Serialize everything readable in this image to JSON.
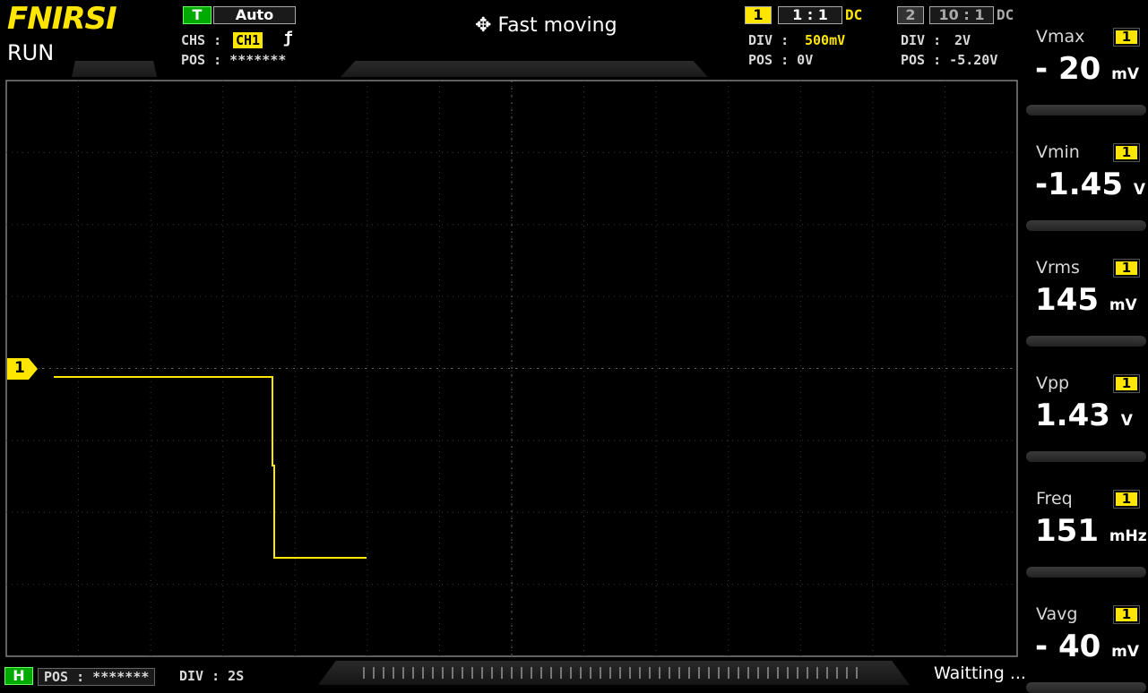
{
  "header": {
    "brand": "FNIRSI",
    "run_state": "RUN",
    "trigger": {
      "badge": "T",
      "mode": "Auto",
      "chs_label": "CHS :",
      "channel": "CH1",
      "edge_symbol": "ƒ",
      "pos_label": "POS : *******"
    },
    "title": "Fast moving",
    "ch1": {
      "num": "1",
      "probe": "1 : 1",
      "coupling": "DC",
      "div_label": "DIV :",
      "div_value": "500mV",
      "pos_label": "POS : 0V"
    },
    "ch2": {
      "num": "2",
      "probe": "10 : 1",
      "coupling": "DC",
      "div_label": "DIV :",
      "div_value": "2V",
      "pos_label": "POS : -5.20V"
    }
  },
  "measurements": [
    {
      "label": "Vmax",
      "badge": "1",
      "value": "- 20",
      "unit": "mV"
    },
    {
      "label": "Vmin",
      "badge": "1",
      "value": "-1.45",
      "unit": "V"
    },
    {
      "label": "Vrms",
      "badge": "1",
      "value": "145",
      "unit": "mV"
    },
    {
      "label": "Vpp",
      "badge": "1",
      "value": "1.43",
      "unit": "V"
    },
    {
      "label": "Freq",
      "badge": "1",
      "value": "151",
      "unit": "mHz"
    },
    {
      "label": "Vavg",
      "badge": "1",
      "value": "- 40",
      "unit": "mV"
    }
  ],
  "footer": {
    "h_badge": "H",
    "pos_label": "POS : *******",
    "div_label": "DIV : 2S",
    "status": "Waitting ..."
  },
  "channel_marker": "1",
  "colors": {
    "trace": "#ffe600",
    "grid": "#555555",
    "panel": "#1c1c1c"
  }
}
